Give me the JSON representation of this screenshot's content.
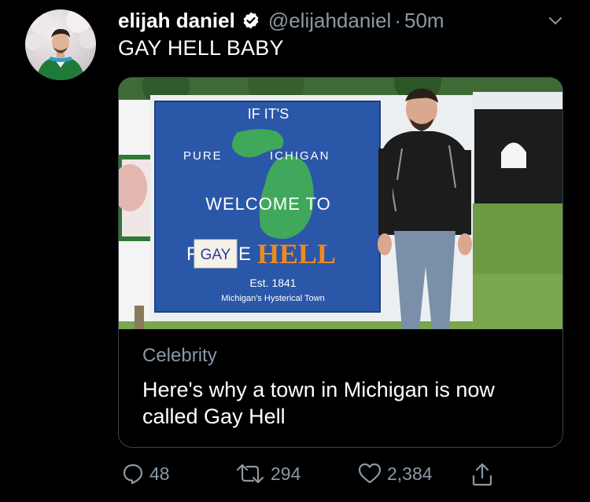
{
  "tweet": {
    "author_name": "elijah daniel",
    "handle": "@elijahdaniel",
    "separator": "·",
    "time": "50m",
    "text": "GAY HELL BABY"
  },
  "card": {
    "image_sign": {
      "line1": "IF IT'S",
      "pure_left": "PURE",
      "pure_right": "ICHIGAN",
      "welcome": "WELCOME TO",
      "the_letter": "F",
      "gay_patch": "GAY",
      "the_end": "E",
      "hell": "HELL",
      "est": "Est. 1841",
      "tagline": "Michigan's Hysterical Town"
    },
    "category": "Celebrity",
    "title": "Here's why a town in Michigan is now called Gay Hell"
  },
  "actions": {
    "replies": "48",
    "retweets": "294",
    "likes": "2,384"
  },
  "colors": {
    "background": "#000000",
    "secondary_text": "#8b98a5",
    "card_border": "#38444d",
    "verified_blue": "#1da1f2",
    "sign_blue": "#2a57a8",
    "hell_orange": "#f08a1c"
  }
}
